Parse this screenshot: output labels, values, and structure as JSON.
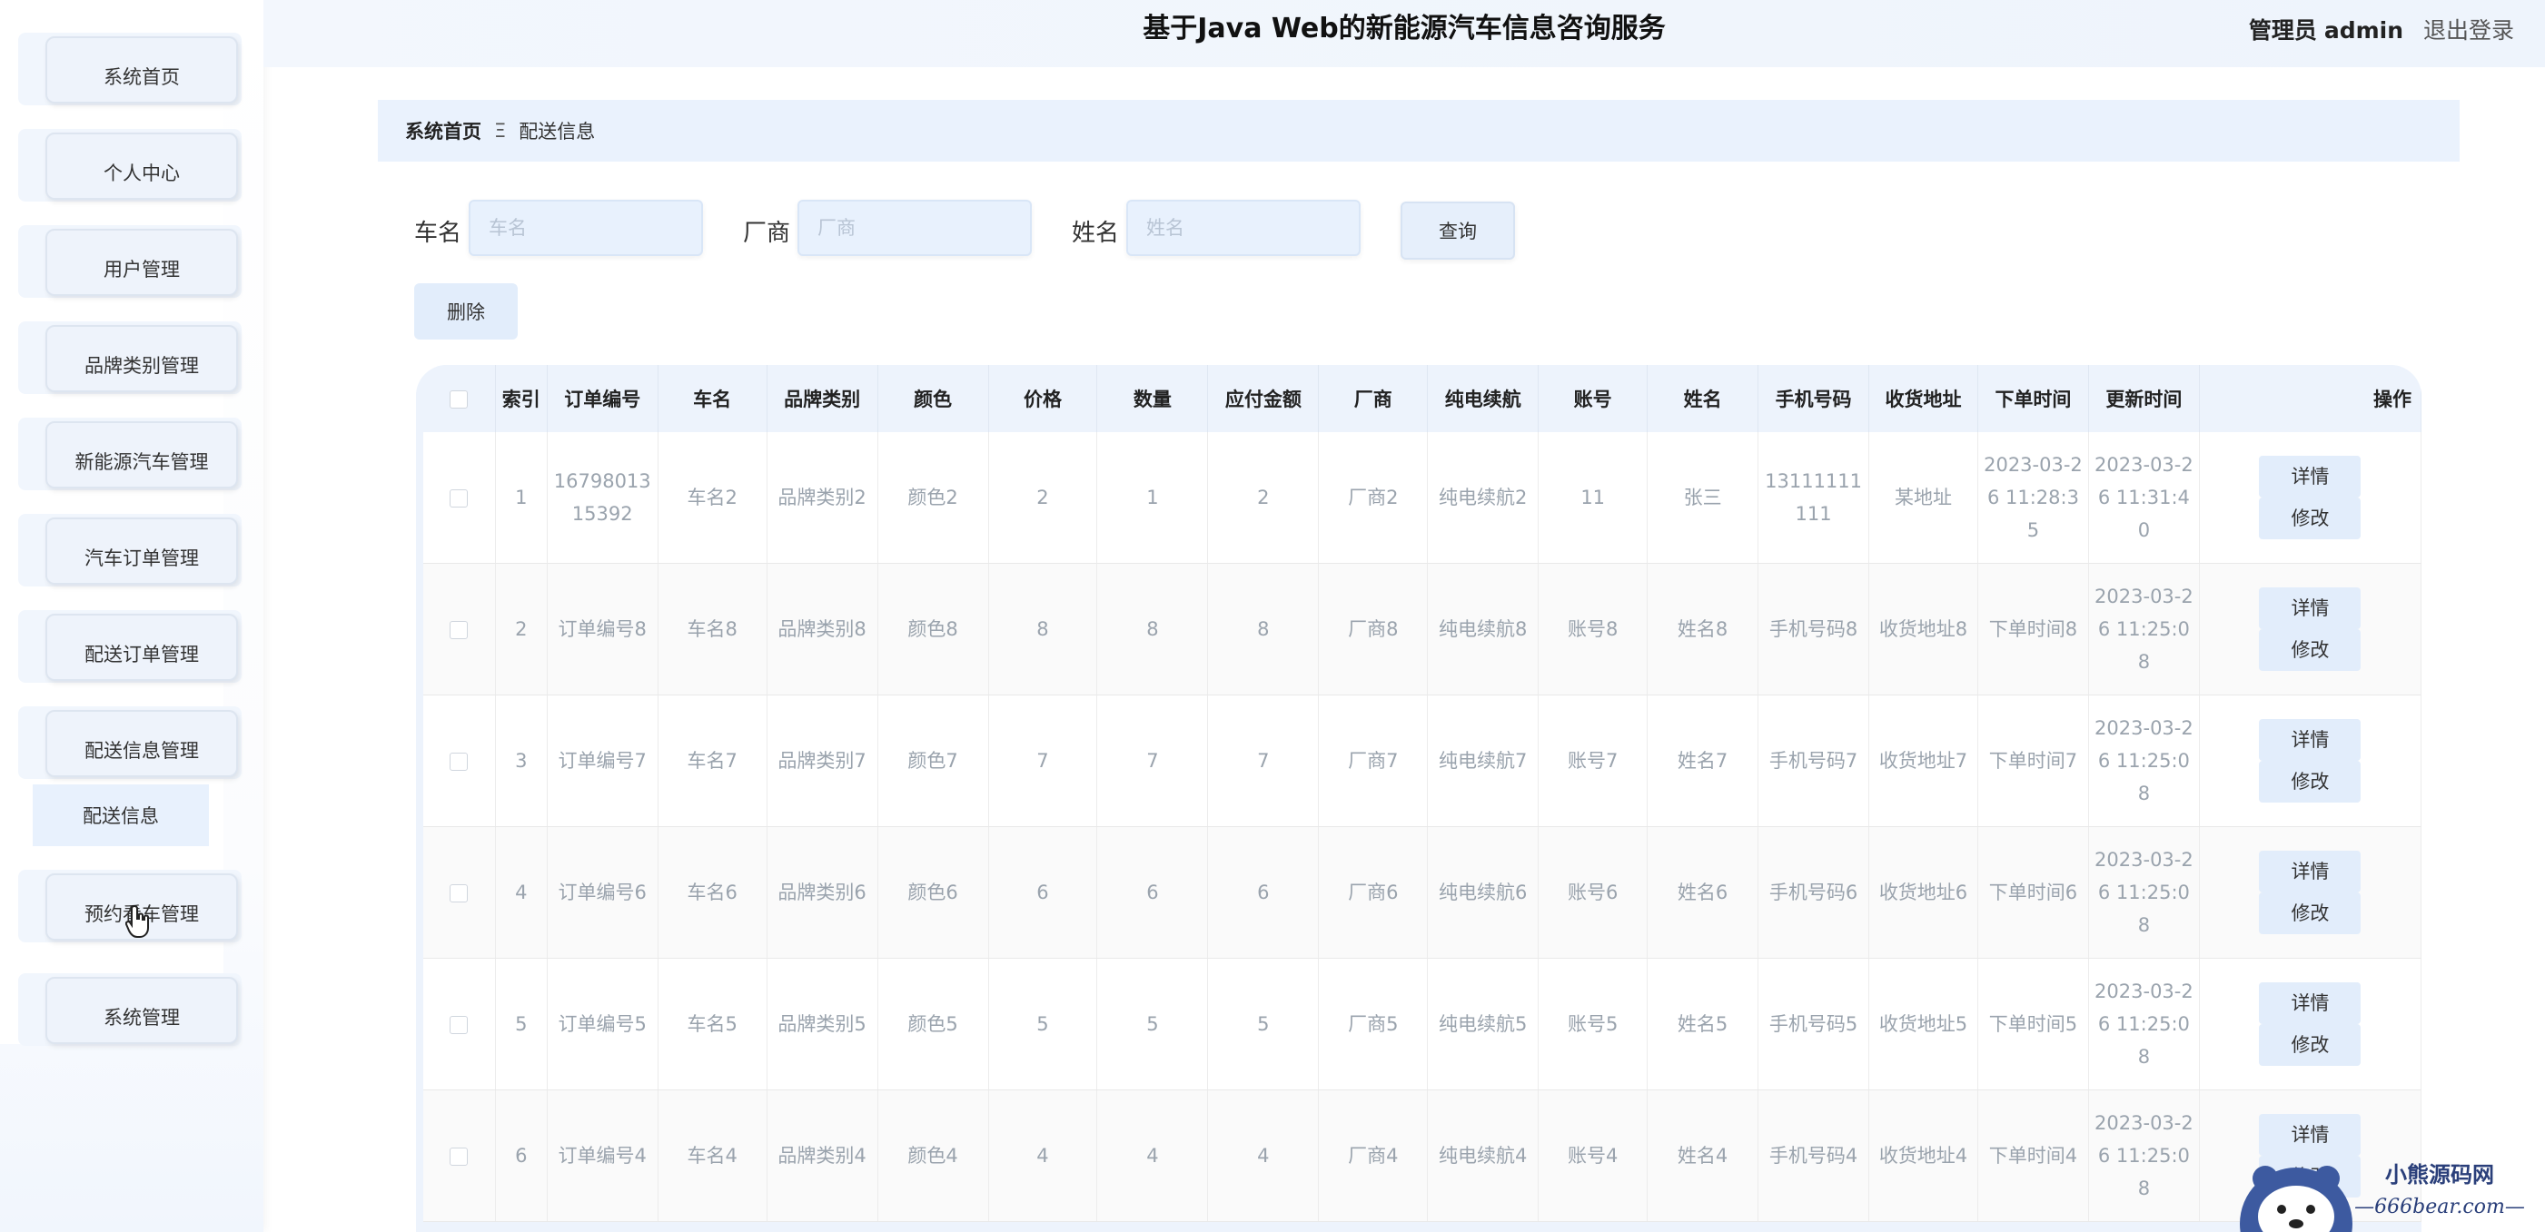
{
  "header": {
    "title": "基于Java Web的新能源汽车信息咨询服务",
    "role": "管理员",
    "username": "admin",
    "logout": "退出登录"
  },
  "sidebar": {
    "items": [
      {
        "label": "系统首页"
      },
      {
        "label": "个人中心"
      },
      {
        "label": "用户管理"
      },
      {
        "label": "品牌类别管理"
      },
      {
        "label": "新能源汽车管理"
      },
      {
        "label": "汽车订单管理"
      },
      {
        "label": "配送订单管理"
      },
      {
        "label": "配送信息管理"
      },
      {
        "label": "预约看车管理"
      },
      {
        "label": "系统管理"
      }
    ],
    "submenu": {
      "label": "配送信息"
    }
  },
  "breadcrumb": {
    "home": "系统首页",
    "separator": "Ξ",
    "current": "配送信息"
  },
  "search": {
    "car_name": {
      "label": "车名",
      "placeholder": "车名"
    },
    "vendor": {
      "label": "厂商",
      "placeholder": "厂商"
    },
    "name": {
      "label": "姓名",
      "placeholder": "姓名"
    },
    "query_button": "查询",
    "delete_button": "删除"
  },
  "table": {
    "headers": [
      "索引",
      "订单编号",
      "车名",
      "品牌类别",
      "颜色",
      "价格",
      "数量",
      "应付金额",
      "厂商",
      "纯电续航",
      "账号",
      "姓名",
      "手机号码",
      "收货地址",
      "下单时间",
      "更新时间",
      "操作"
    ],
    "rows": [
      {
        "cells": [
          "1",
          "1679801315392",
          "车名2",
          "品牌类别2",
          "颜色2",
          "2",
          "1",
          "2",
          "厂商2",
          "纯电续航2",
          "11",
          "张三",
          "13111111111",
          "某地址",
          "2023-03-26 11:28:35",
          "2023-03-26 11:31:40"
        ]
      },
      {
        "cells": [
          "2",
          "订单编号8",
          "车名8",
          "品牌类别8",
          "颜色8",
          "8",
          "8",
          "8",
          "厂商8",
          "纯电续航8",
          "账号8",
          "姓名8",
          "手机号码8",
          "收货地址8",
          "下单时间8",
          "2023-03-26 11:25:08"
        ]
      },
      {
        "cells": [
          "3",
          "订单编号7",
          "车名7",
          "品牌类别7",
          "颜色7",
          "7",
          "7",
          "7",
          "厂商7",
          "纯电续航7",
          "账号7",
          "姓名7",
          "手机号码7",
          "收货地址7",
          "下单时间7",
          "2023-03-26 11:25:08"
        ]
      },
      {
        "cells": [
          "4",
          "订单编号6",
          "车名6",
          "品牌类别6",
          "颜色6",
          "6",
          "6",
          "6",
          "厂商6",
          "纯电续航6",
          "账号6",
          "姓名6",
          "手机号码6",
          "收货地址6",
          "下单时间6",
          "2023-03-26 11:25:08"
        ]
      },
      {
        "cells": [
          "5",
          "订单编号5",
          "车名5",
          "品牌类别5",
          "颜色5",
          "5",
          "5",
          "5",
          "厂商5",
          "纯电续航5",
          "账号5",
          "姓名5",
          "手机号码5",
          "收货地址5",
          "下单时间5",
          "2023-03-26 11:25:08"
        ]
      },
      {
        "cells": [
          "6",
          "订单编号4",
          "车名4",
          "品牌类别4",
          "颜色4",
          "4",
          "4",
          "4",
          "厂商4",
          "纯电续航4",
          "账号4",
          "姓名4",
          "手机号码4",
          "收货地址4",
          "下单时间4",
          "2023-03-26 11:25:08"
        ]
      }
    ],
    "actions": {
      "detail": "详情",
      "edit": "修改"
    }
  },
  "watermark": {
    "line1": "小熊源码网",
    "line2": "—666bear.com—"
  },
  "colors": {
    "accent": "#e2edfb",
    "header_bg": "#edf3fc"
  }
}
